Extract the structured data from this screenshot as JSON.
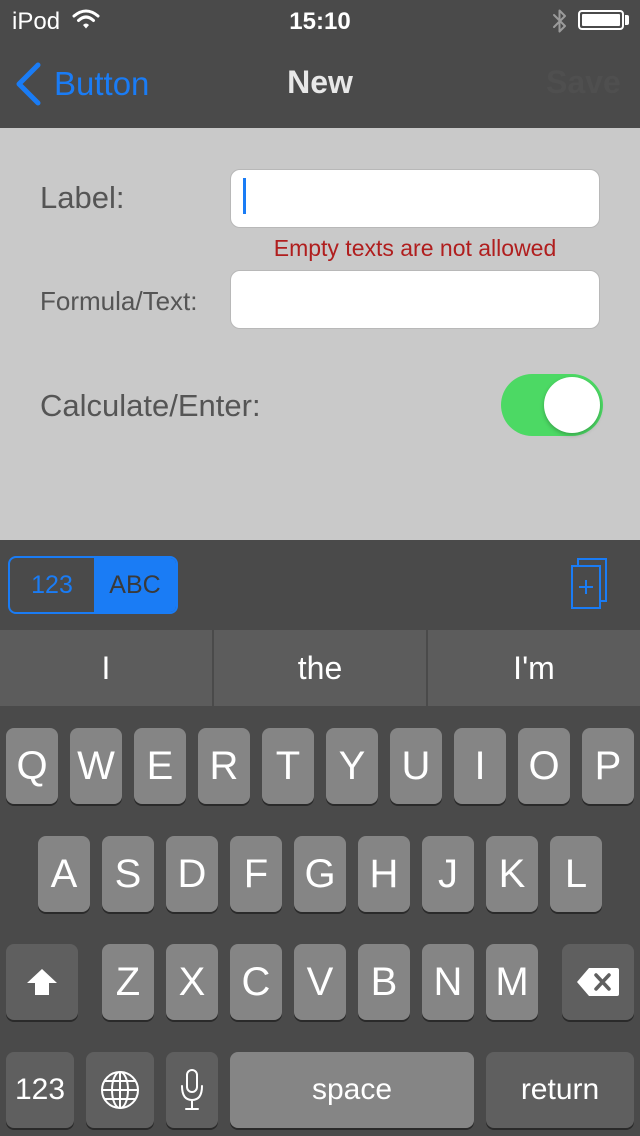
{
  "status_bar": {
    "carrier": "iPod",
    "time": "15:10"
  },
  "nav": {
    "back_label": "Button",
    "title": "New",
    "save_label": "Save"
  },
  "form": {
    "label_caption": "Label:",
    "label_value": "",
    "error_message": "Empty texts are not allowed",
    "formula_caption": "Formula/Text:",
    "formula_value": "",
    "calculate_caption": "Calculate/Enter:",
    "calculate_on": true
  },
  "accessory": {
    "seg_numeric": "123",
    "seg_alpha": "ABC",
    "selected": "ABC"
  },
  "predictions": [
    "I",
    "the",
    "I'm"
  ],
  "keyboard": {
    "row1": [
      "Q",
      "W",
      "E",
      "R",
      "T",
      "Y",
      "U",
      "I",
      "O",
      "P"
    ],
    "row2": [
      "A",
      "S",
      "D",
      "F",
      "G",
      "H",
      "J",
      "K",
      "L"
    ],
    "row3": [
      "Z",
      "X",
      "C",
      "V",
      "B",
      "N",
      "M"
    ],
    "numbers_key": "123",
    "space_key": "space",
    "return_key": "return"
  },
  "colors": {
    "accent": "#1a7cf5",
    "toggle_on": "#4cd964",
    "error": "#b01e1e"
  },
  "icons": [
    "wifi-icon",
    "bluetooth-icon",
    "battery-icon",
    "back-chevron-icon",
    "pages-icon",
    "shift-icon",
    "backspace-icon",
    "globe-icon",
    "mic-icon"
  ]
}
